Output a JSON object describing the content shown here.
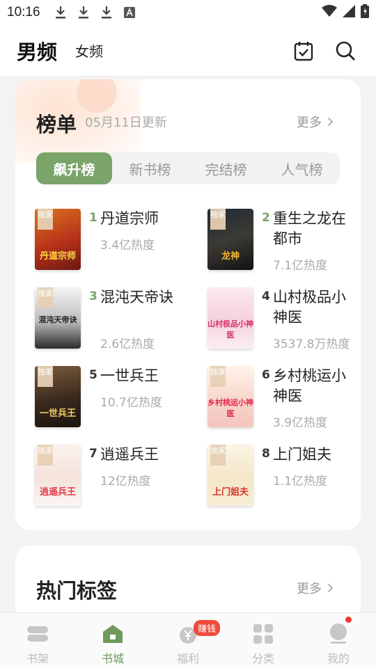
{
  "status": {
    "time": "10:16"
  },
  "header": {
    "tab_male": "男频",
    "tab_female": "女频"
  },
  "rank": {
    "title": "榜单",
    "updated": "05月11日更新",
    "more": "更多",
    "tabs": [
      "飙升榜",
      "新书榜",
      "完结榜",
      "人气榜"
    ],
    "badge": "独家",
    "books": [
      {
        "rank": "1",
        "name": "丹道宗师",
        "heat": "3.4亿热度",
        "cover_text": "丹道宗师",
        "exclusive": true
      },
      {
        "rank": "2",
        "name": "重生之龙在都市",
        "heat": "7.1亿热度",
        "cover_text": "龙神",
        "exclusive": true
      },
      {
        "rank": "3",
        "name": "混沌天帝诀",
        "heat": "2.6亿热度",
        "cover_text": "混沌天帝诀",
        "exclusive": true
      },
      {
        "rank": "4",
        "name": "山村极品小神医",
        "heat": "3537.8万热度",
        "cover_text": "山村极品小神医",
        "exclusive": false
      },
      {
        "rank": "5",
        "name": "一世兵王",
        "heat": "10.7亿热度",
        "cover_text": "一世兵王",
        "exclusive": true
      },
      {
        "rank": "6",
        "name": "乡村桃运小神医",
        "heat": "3.9亿热度",
        "cover_text": "乡村桃运小神医",
        "exclusive": true
      },
      {
        "rank": "7",
        "name": "逍遥兵王",
        "heat": "12亿热度",
        "cover_text": "逍遥兵王",
        "exclusive": true
      },
      {
        "rank": "8",
        "name": "上门姐夫",
        "heat": "1.1亿热度",
        "cover_text": "上门姐夫",
        "exclusive": true
      }
    ]
  },
  "hot_tags": {
    "title": "热门标签",
    "more": "更多"
  },
  "nav": {
    "items": [
      {
        "label": "书架",
        "icon": "bookshelf-icon"
      },
      {
        "label": "书城",
        "icon": "store-icon"
      },
      {
        "label": "福利",
        "icon": "welfare-icon"
      },
      {
        "label": "分类",
        "icon": "category-icon"
      },
      {
        "label": "我的",
        "icon": "profile-icon"
      }
    ],
    "earn_badge": "赚钱"
  },
  "colors": {
    "accent": "#7aa46a",
    "rank_top3": "#7aa46a",
    "badge_red": "#f04a3b"
  }
}
